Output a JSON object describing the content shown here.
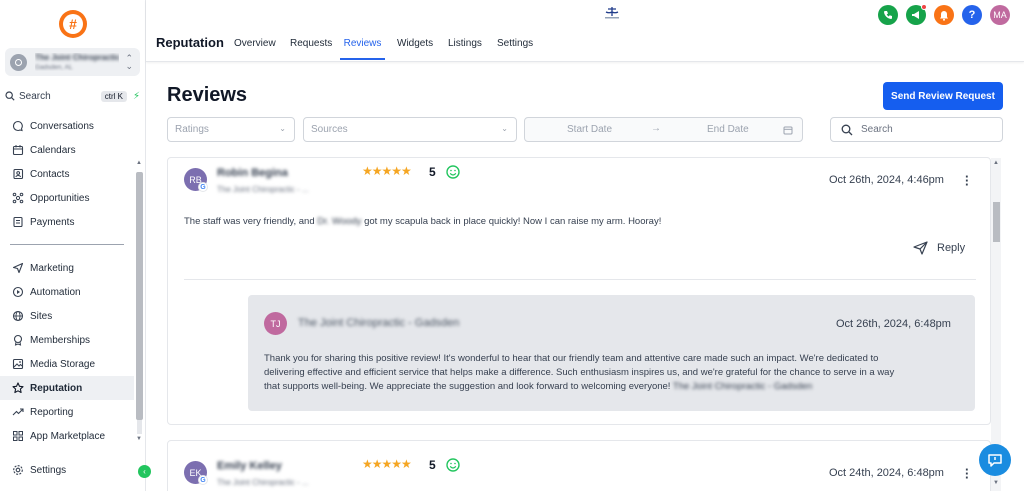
{
  "sidebar": {
    "location": {
      "name": "The Joint Chiropractic - ...",
      "sub": "Gadsden, AL"
    },
    "search": {
      "label": "Search",
      "shortcut": "ctrl K"
    },
    "items": [
      {
        "label": "Conversations",
        "icon": "chat-icon"
      },
      {
        "label": "Calendars",
        "icon": "calendar-icon"
      },
      {
        "label": "Contacts",
        "icon": "contacts-icon"
      },
      {
        "label": "Opportunities",
        "icon": "opportunities-icon"
      },
      {
        "label": "Payments",
        "icon": "payments-icon"
      },
      {
        "label": "Marketing",
        "icon": "send-icon"
      },
      {
        "label": "Automation",
        "icon": "automation-icon"
      },
      {
        "label": "Sites",
        "icon": "globe-icon"
      },
      {
        "label": "Memberships",
        "icon": "membership-icon"
      },
      {
        "label": "Media Storage",
        "icon": "image-icon"
      },
      {
        "label": "Reputation",
        "icon": "star-icon"
      },
      {
        "label": "Reporting",
        "icon": "chart-line-icon"
      },
      {
        "label": "App Marketplace",
        "icon": "grid-icon"
      }
    ],
    "settings_label": "Settings"
  },
  "header": {
    "section": "Reputation",
    "tabs": [
      "Overview",
      "Requests",
      "Reviews",
      "Widgets",
      "Listings",
      "Settings"
    ],
    "active_tab": "Reviews",
    "user_initials": "MA",
    "colors": {
      "phone": "#16a34a",
      "megaphone": "#16a34a",
      "bell": "#f97316",
      "help": "#2563eb",
      "avatar": "#c06a9f"
    }
  },
  "main": {
    "title": "Reviews",
    "send_button": "Send Review Request",
    "filters": {
      "ratings": "Ratings",
      "sources": "Sources",
      "start_date": "Start Date",
      "end_date": "End Date",
      "search": "Search"
    }
  },
  "reviews": [
    {
      "initials": "RB",
      "name": "Robin Begina",
      "business": "The Joint Chiropractic - ...",
      "stars": "★★★★★",
      "rating": "5",
      "date": "Oct 26th, 2024, 4:46pm",
      "text_before": "The staff was very friendly, and",
      "text_blurred": "Dr. Woody",
      "text_after": "got my scapula back in place quickly! Now I can raise my arm. Hooray!",
      "reply_label": "Reply",
      "reply": {
        "initials": "TJ",
        "name": "The Joint Chiropractic - Gadsden",
        "date": "Oct 26th, 2024, 6:48pm",
        "line1": "Thank you for sharing this positive review! It's wonderful to hear that our friendly team and attentive care made such an impact. We're dedicated to",
        "line2": "delivering effective and efficient service that helps make a difference. Such enthusiasm inspires us, and we're grateful for the chance to serve in a way",
        "line3": "that supports well-being. We appreciate the suggestion and look forward to welcoming everyone!",
        "line3_blurred": "The Joint Chiropractic - Gadsden"
      }
    },
    {
      "initials": "EK",
      "name": "Emily Kelley",
      "business": "The Joint Chiropractic - ...",
      "stars": "★★★★★",
      "rating": "5",
      "date": "Oct 24th, 2024, 6:48pm"
    }
  ]
}
